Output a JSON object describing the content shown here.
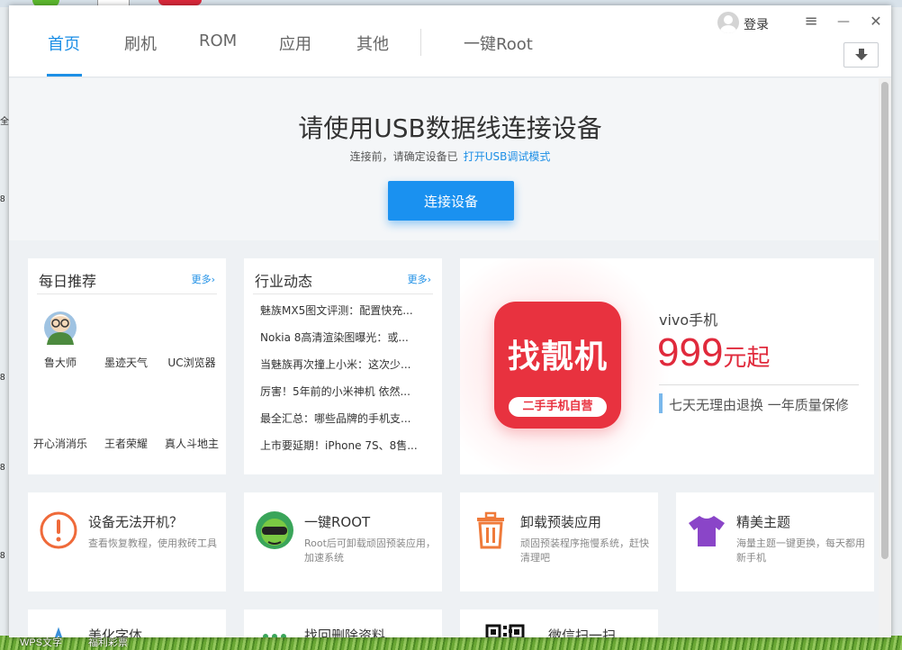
{
  "desktop": {
    "left_edge_chars": [
      "全",
      "8",
      "8",
      "8",
      "8"
    ],
    "taskbar_items": [
      "WPS文字",
      "福利彩票"
    ]
  },
  "window": {
    "tabs": [
      {
        "label": "首页",
        "active": true
      },
      {
        "label": "刷机"
      },
      {
        "label": "ROM"
      },
      {
        "label": "应用"
      },
      {
        "label": "其他"
      },
      {
        "label": "一键Root"
      }
    ],
    "login_label": "登录",
    "controls": {
      "menu": "≡",
      "minimize": "—",
      "close": "✕"
    },
    "accent_color": "#1d8fe6"
  },
  "hero": {
    "title": "请使用USB数据线连接设备",
    "subtitle": "连接前，请确定设备已",
    "subtitle_link": "打开USB调试模式",
    "button_label": "连接设备"
  },
  "daily": {
    "title": "每日推荐",
    "more": "更多›",
    "apps": [
      "鲁大师",
      "墨迹天气",
      "UC浏览器",
      "开心消消乐",
      "王者荣耀",
      "真人斗地主"
    ]
  },
  "news": {
    "title": "行业动态",
    "more": "更多›",
    "items": [
      "魅族MX5图文评测：配置快充...",
      "Nokia 8高清渲染图曝光：或...",
      "当魅族再次撞上小米：这次少...",
      "厉害！5年前的小米神机 依然...",
      "最全汇总：哪些品牌的手机支...",
      "上市要延期！iPhone 7S、8售..."
    ]
  },
  "ad": {
    "logo_text": "找靓机",
    "logo_tag": "二手手机自营",
    "brand": "vivo手机",
    "price": "999",
    "price_unit": "元起",
    "tagline": "七天无理由退换 一年质量保修",
    "price_color": "#e02a3c"
  },
  "features": [
    {
      "title": "设备无法开机？",
      "desc": "查看恢复教程，使用救砖工具",
      "icon": "exclamation-icon"
    },
    {
      "title": "一键ROOT",
      "desc": "Root后可卸载顽固预装应用，加速系统",
      "icon": "root-mascot-icon"
    },
    {
      "title": "卸载预装应用",
      "desc": "顽固预装程序拖慢系统，赶快清理吧",
      "icon": "trash-icon"
    },
    {
      "title": "精美主题",
      "desc": "海量主题一键更换，每天都用新手机",
      "icon": "tshirt-icon"
    }
  ],
  "features_row2": [
    {
      "title": "美化字体",
      "icon": "font-icon"
    },
    {
      "title": "找回删除资料",
      "icon": "recover-icon"
    },
    {
      "title": "微信扫一扫",
      "icon": "qrcode-icon"
    }
  ]
}
